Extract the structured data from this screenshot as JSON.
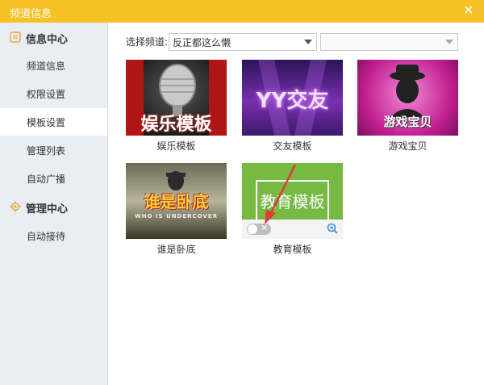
{
  "window": {
    "title": "频道信息",
    "close_glyph": "✕"
  },
  "sidebar": {
    "sections": [
      {
        "label": "信息中心",
        "icon": "document-icon",
        "items": [
          "频道信息",
          "权限设置",
          "模板设置",
          "管理列表",
          "自动广播"
        ]
      },
      {
        "label": "管理中心",
        "icon": "gear-icon",
        "items": [
          "自动接待"
        ]
      }
    ],
    "active_item": "模板设置"
  },
  "main": {
    "select_label": "选择频道:",
    "channel_select_value": "反正都这么懒",
    "second_select_value": "",
    "templates": [
      {
        "name": "娱乐模板",
        "thumb_text": "娱乐模板"
      },
      {
        "name": "交友模板",
        "thumb_text": "YY交友"
      },
      {
        "name": "游戏宝贝",
        "thumb_text": "游戏宝贝"
      },
      {
        "name": "谁是卧底",
        "thumb_text": "谁是卧底",
        "thumb_sub": "WHO IS UNDERCOVER"
      },
      {
        "name": "教育模板",
        "thumb_text": "教育模板",
        "toggle_on": false
      }
    ]
  },
  "colors": {
    "titlebar": "#f5c125",
    "sidebar_bg": "#e9eef2",
    "edu_green": "#76b943",
    "accent_red": "#e03a3a"
  }
}
